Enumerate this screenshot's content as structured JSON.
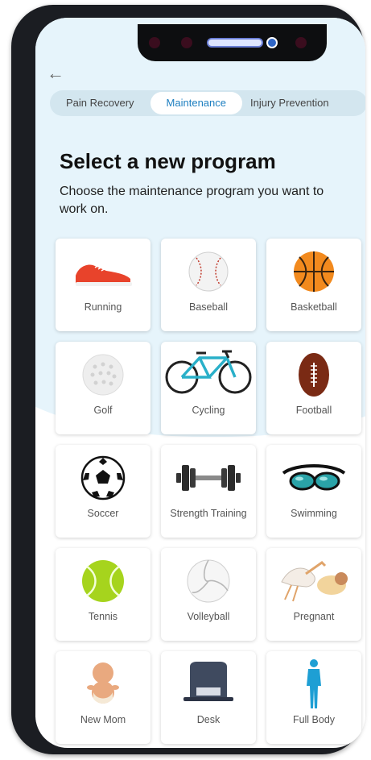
{
  "nav": {
    "back_glyph": "←"
  },
  "tabs": [
    {
      "label": "Pain Recovery",
      "active": false
    },
    {
      "label": "Maintenance",
      "active": true
    },
    {
      "label": "Injury Prevention",
      "active": false
    }
  ],
  "header": {
    "title": "Select a new program",
    "subtitle": "Choose the maintenance program you want to work on."
  },
  "programs": [
    {
      "label": "Running",
      "icon": "running-shoe-icon"
    },
    {
      "label": "Baseball",
      "icon": "baseball-icon"
    },
    {
      "label": "Basketball",
      "icon": "basketball-icon"
    },
    {
      "label": "Golf",
      "icon": "golf-ball-icon"
    },
    {
      "label": "Cycling",
      "icon": "bicycle-icon"
    },
    {
      "label": "Football",
      "icon": "football-icon"
    },
    {
      "label": "Soccer",
      "icon": "soccer-ball-icon"
    },
    {
      "label": "Strength Training",
      "icon": "dumbbell-icon"
    },
    {
      "label": "Swimming",
      "icon": "swim-goggles-icon"
    },
    {
      "label": "Tennis",
      "icon": "tennis-ball-icon"
    },
    {
      "label": "Volleyball",
      "icon": "volleyball-icon"
    },
    {
      "label": "Pregnant",
      "icon": "stork-icon"
    },
    {
      "label": "New Mom",
      "icon": "baby-icon"
    },
    {
      "label": "Desk",
      "icon": "desk-chair-icon"
    },
    {
      "label": "Full Body",
      "icon": "human-body-icon"
    }
  ],
  "colors": {
    "accent": "#1e7fc0",
    "background": "#e6f4fb",
    "tab_track": "#d3e6ef"
  }
}
